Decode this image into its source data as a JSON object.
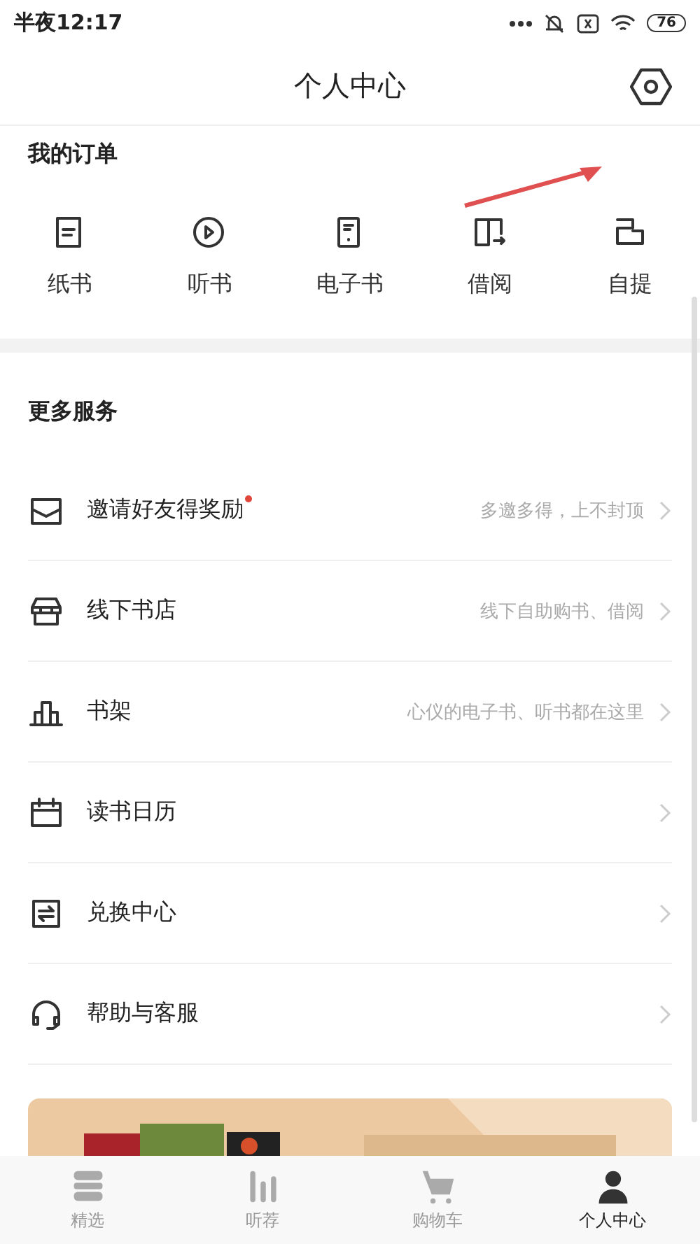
{
  "status_bar": {
    "time": "半夜12:17",
    "battery": "76"
  },
  "header": {
    "title": "个人中心"
  },
  "orders": {
    "title": "我的订单",
    "items": [
      {
        "label": "纸书",
        "kind": "paper"
      },
      {
        "label": "听书",
        "kind": "audio"
      },
      {
        "label": "电子书",
        "kind": "ebook"
      },
      {
        "label": "借阅",
        "kind": "borrow"
      },
      {
        "label": "自提",
        "kind": "pickup"
      }
    ]
  },
  "services": {
    "title": "更多服务",
    "items": [
      {
        "label": "邀请好友得奖励",
        "hint": "多邀多得，上不封顶",
        "kind": "invite",
        "badge": true
      },
      {
        "label": "线下书店",
        "hint": "线下自助购书、借阅",
        "kind": "store",
        "badge": false
      },
      {
        "label": "书架",
        "hint": "心仪的电子书、听书都在这里",
        "kind": "shelf",
        "badge": false
      },
      {
        "label": "读书日历",
        "kind": "calendar",
        "badge": false
      },
      {
        "label": "兑换中心",
        "kind": "exchange",
        "badge": false
      },
      {
        "label": "帮助与客服",
        "kind": "help",
        "badge": false
      }
    ]
  },
  "tab_bar": [
    {
      "label": "精选",
      "kind": "featured",
      "selected": false
    },
    {
      "label": "听荐",
      "kind": "listen",
      "selected": false
    },
    {
      "label": "购物车",
      "kind": "cart",
      "selected": false
    },
    {
      "label": "个人中心",
      "kind": "me",
      "selected": true
    }
  ]
}
